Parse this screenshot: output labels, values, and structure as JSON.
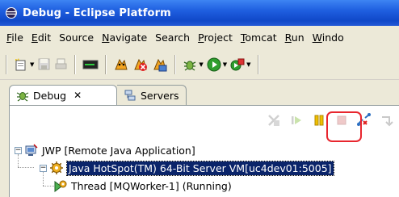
{
  "window": {
    "title": "Debug - Eclipse Platform"
  },
  "menubar": {
    "items": [
      {
        "mnemonic": "F",
        "rest": "ile"
      },
      {
        "mnemonic": "E",
        "rest": "dit"
      },
      {
        "mnemonic": "",
        "rest": "Source"
      },
      {
        "mnemonic": "N",
        "rest": "avigate"
      },
      {
        "mnemonic": "",
        "rest": "Search"
      },
      {
        "mnemonic": "P",
        "rest": "roject"
      },
      {
        "mnemonic": "T",
        "rest": "omcat"
      },
      {
        "mnemonic": "R",
        "rest": "un"
      },
      {
        "mnemonic": "W",
        "rest": "indo"
      }
    ]
  },
  "toolbar": {
    "icons": [
      "new-wizard-icon",
      "save-icon",
      "print-icon",
      "console-icon",
      "tomcat-start-icon",
      "tomcat-stop-icon",
      "tomcat-restart-icon",
      "debug-icon",
      "run-icon",
      "external-tools-icon"
    ]
  },
  "tabs": {
    "debug": {
      "label": "Debug",
      "close": "✕"
    },
    "servers": {
      "label": "Servers"
    }
  },
  "pane_toolbar": {
    "icons": [
      "remove-terminated-icon",
      "resume-icon",
      "suspend-icon",
      "terminate-icon",
      "disconnect-icon",
      "step-into-icon"
    ]
  },
  "tree": {
    "nodes": [
      {
        "label": "JWP [Remote Java Application]",
        "expander": "−"
      },
      {
        "label": "Java HotSpot(TM) 64-Bit Server VM[uc4dev01:5005]",
        "expander": "−"
      },
      {
        "label": "Thread [MQWorker-1] (Running)"
      }
    ]
  },
  "colors": {
    "titlebar": "#1f5fe0",
    "chrome": "#ece9d8",
    "selection": "#0a246a",
    "highlight": "#e8262e"
  }
}
